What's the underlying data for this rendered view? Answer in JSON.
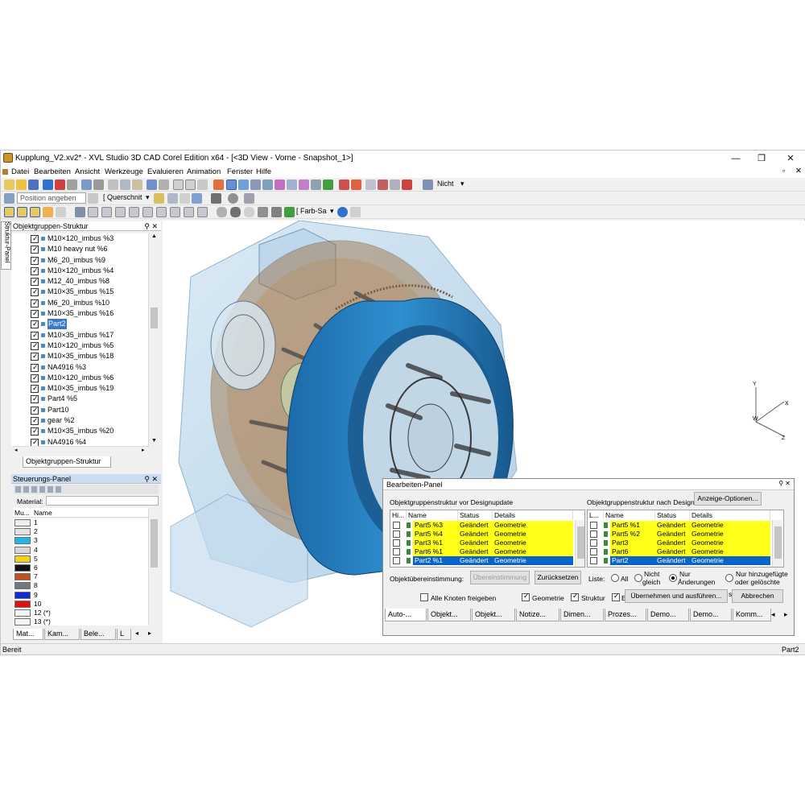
{
  "window": {
    "title": "Kupplung_V2.xv2* - XVL Studio 3D CAD Corel Edition x64 - [<3D View - Vorne - Snapshot_1>]",
    "minimize": "—",
    "restore": "❐",
    "close": "✕",
    "doc_close": "✕",
    "doc_restore": "▫"
  },
  "menu": [
    "Datei",
    "Bearbeiten",
    "Ansicht",
    "Werkzeuge",
    "Evaluieren",
    "Animation",
    "Fenster",
    "Hilfe"
  ],
  "toolbar": {
    "nicht_label": "Nicht",
    "position_combo": "Position angeben",
    "querschnitt_label": "[ Querschnit",
    "farb_label": "[ Farb-Sa"
  },
  "left_panel": {
    "vertical_tab": "Struktur-Panel",
    "header": "Objektgruppen-Struktur",
    "tree_items": [
      "M10×120_imbus %3",
      "M10 heavy nut %6",
      "M6_20_imbus %9",
      "M10×120_imbus %4",
      "M12_40_imbus %8",
      "M10×35_imbus %15",
      "M6_20_imbus %10",
      "M10×35_imbus %16",
      "Part2",
      "M10×35_imbus %17",
      "M10×120_imbus %5",
      "M10×35_imbus %18",
      "NA4916 %3",
      "M10×120_imbus %6",
      "M10×35_imbus %19",
      "Part4 %5",
      "Part10",
      "gear %2",
      "M10×35_imbus %20",
      "NA4916 %4"
    ],
    "selected_item": "Part2",
    "bottom_tab": "Objektgruppen-Struktur"
  },
  "control_panel": {
    "header": "Steuerungs-Panel",
    "material_label": "Material:",
    "col_mu": "Mu...",
    "col_name": "Name",
    "materials": [
      {
        "name": "1",
        "color": "#ececec"
      },
      {
        "name": "2",
        "color": "#e2e2e2"
      },
      {
        "name": "3",
        "color": "#1fb7e8"
      },
      {
        "name": "4",
        "color": "#d6d6d6"
      },
      {
        "name": "5",
        "color": "#f5d21c"
      },
      {
        "name": "6",
        "color": "#111111"
      },
      {
        "name": "7",
        "color": "#c0501f"
      },
      {
        "name": "8",
        "color": "#707880"
      },
      {
        "name": "9",
        "color": "#1428d8"
      },
      {
        "name": "10",
        "color": "#e01010"
      },
      {
        "name": "12 (*)",
        "color": "#f4f4f4"
      },
      {
        "name": "13 (*)",
        "color": "#f4f4f4"
      }
    ],
    "tabs": [
      "Mat...",
      "Kam...",
      "Bele...",
      "L"
    ]
  },
  "axes": {
    "y": "Y",
    "x": "X",
    "w": "W",
    "z": "Z"
  },
  "edit_panel": {
    "title": "Bearbeiten-Panel",
    "left_caption": "Objektgruppenstruktur vor Designupdate",
    "right_caption": "Objektgruppenstruktur nach Design",
    "display_options": "Anzeige-Optionen...",
    "left_headers": [
      "Hi...",
      "Name",
      "Status",
      "Details"
    ],
    "right_headers": [
      "L...",
      "Name",
      "Status",
      "Details"
    ],
    "left_rows": [
      {
        "name": "Part5 %3",
        "status": "Geändert",
        "details": "Geometrie"
      },
      {
        "name": "Part5 %4",
        "status": "Geändert",
        "details": "Geometrie"
      },
      {
        "name": "Part3 %1",
        "status": "Geändert",
        "details": "Geometrie"
      },
      {
        "name": "Part6 %1",
        "status": "Geändert",
        "details": "Geometrie"
      },
      {
        "name": "Part2 %1",
        "status": "Geändert",
        "details": "Geometrie"
      }
    ],
    "right_rows": [
      {
        "name": "Part5 %1",
        "status": "Geändert",
        "details": "Geometrie"
      },
      {
        "name": "Part5 %2",
        "status": "Geändert",
        "details": "Geometrie"
      },
      {
        "name": "Part3",
        "status": "Geändert",
        "details": "Geometrie"
      },
      {
        "name": "Part6",
        "status": "Geändert",
        "details": "Geometrie"
      },
      {
        "name": "Part2",
        "status": "Geändert",
        "details": "Geometrie"
      }
    ],
    "match_label": "Objektübereinstimmung:",
    "match_btn": "Übereinstimmung",
    "reset_btn": "Zurücksetzen",
    "list_label": "Liste:",
    "radio_all": "All",
    "radio_not_same_1": "Nicht",
    "radio_not_same_2": "gleich",
    "radio_only_changes_1": "Nur",
    "radio_only_changes_2": "Änderungen",
    "radio_added_1": "Nur hinzugefügte",
    "radio_added_2": "oder gelöschte",
    "release_all": "Alle Knoten freigeben",
    "cb_geometry": "Geometrie",
    "cb_structure": "Struktur",
    "cb_e": "E",
    "cb_s": "s",
    "apply_btn": "Übernehmen und ausführen...",
    "cancel_btn": "Abbrechen",
    "tabs": [
      "Auto-...",
      "Objekt...",
      "Objekt...",
      "Notize...",
      "Dimen...",
      "Prozes...",
      "Demo...",
      "Demo...",
      "Komm..."
    ]
  },
  "status": {
    "left": "Bereit",
    "right": "Part2"
  }
}
